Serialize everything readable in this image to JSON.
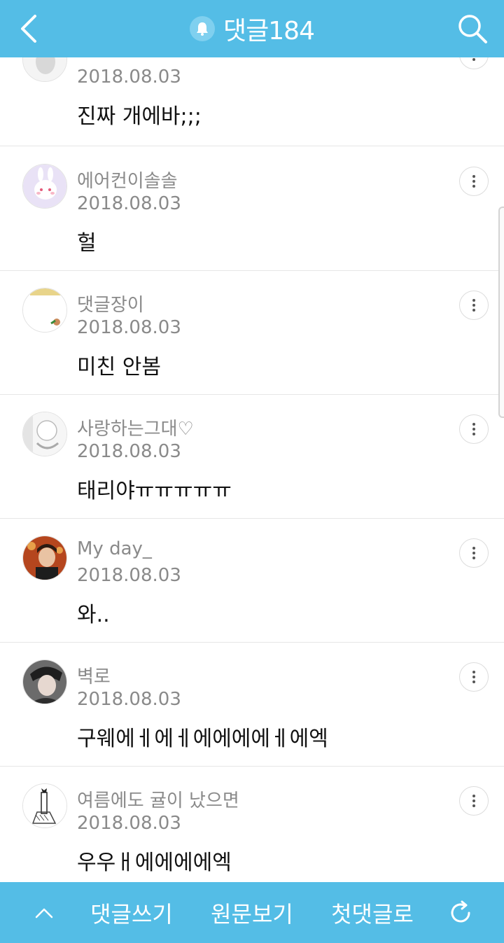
{
  "header": {
    "title": "댓글184",
    "back_icon": "chevron-left-icon",
    "bell_icon": "bell-icon",
    "search_icon": "search-icon"
  },
  "comments": [
    {
      "author": "",
      "date": "2018.08.03",
      "text": "진짜 개에바;;;"
    },
    {
      "author": "에어컨이솔솔",
      "date": "2018.08.03",
      "text": "헐"
    },
    {
      "author": "댓글장이",
      "date": "2018.08.03",
      "text": "미친 안봄"
    },
    {
      "author": "사랑하는그대♡",
      "date": "2018.08.03",
      "text": "태리야ㅠㅠㅠㅠㅠ"
    },
    {
      "author": "My day_",
      "date": "2018.08.03",
      "text": "와.."
    },
    {
      "author": "벽로",
      "date": "2018.08.03",
      "text": "구웨에ㅔ에ㅔ에에에에ㅔ에엑"
    },
    {
      "author": "여름에도 귤이 났으면",
      "date": "2018.08.03",
      "text": "우우ㅐ에에에에엑"
    }
  ],
  "footer": {
    "scroll_top_icon": "chevron-up-icon",
    "write_label": "댓글쓰기",
    "original_label": "원문보기",
    "first_label": "첫댓글로",
    "refresh_icon": "refresh-icon"
  },
  "colors": {
    "brand": "#54bde6",
    "meta_text": "#8a8a8a",
    "body_text": "#111111"
  }
}
